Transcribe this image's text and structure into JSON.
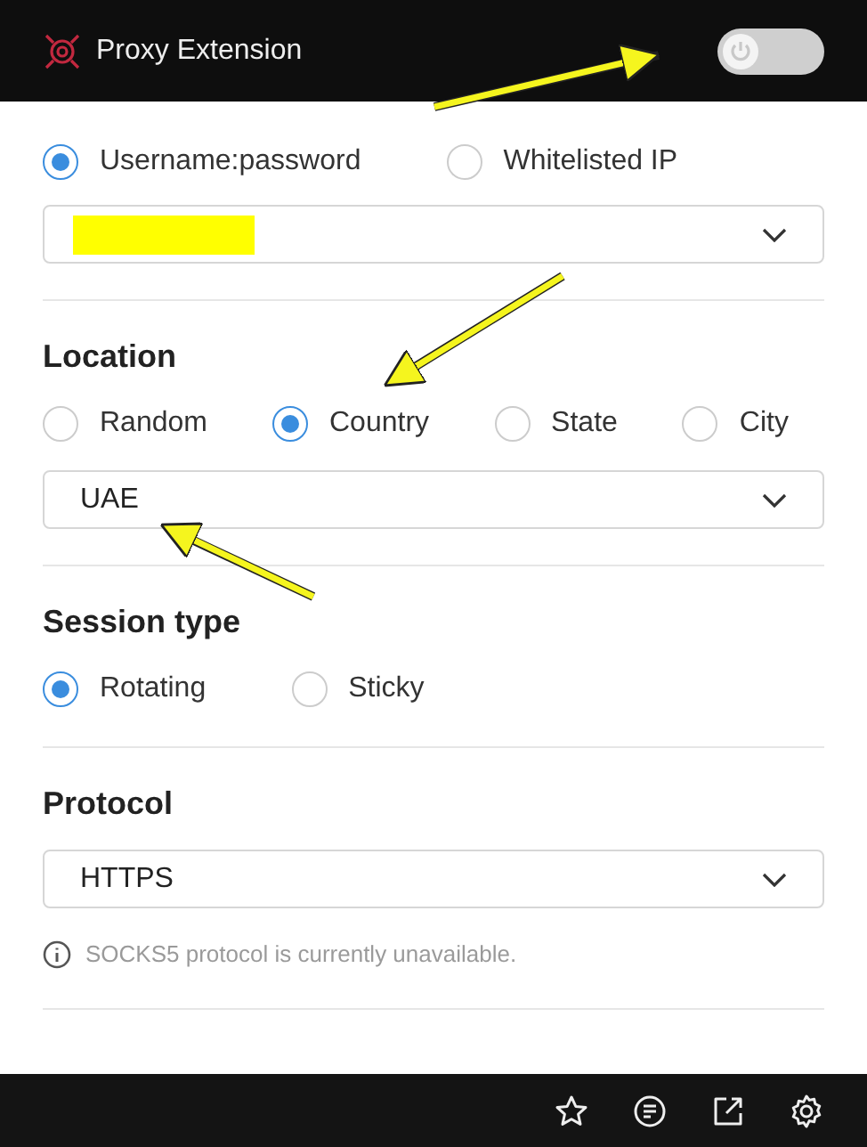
{
  "header": {
    "title": "Proxy Extension",
    "power_toggle": {
      "on": false
    }
  },
  "auth": {
    "options": [
      {
        "label": "Username:password",
        "selected": true
      },
      {
        "label": "Whitelisted IP",
        "selected": false
      }
    ],
    "select": {
      "redacted": true
    }
  },
  "location": {
    "title": "Location",
    "options": [
      {
        "label": "Random",
        "selected": false
      },
      {
        "label": "Country",
        "selected": true
      },
      {
        "label": "State",
        "selected": false
      },
      {
        "label": "City",
        "selected": false
      }
    ],
    "select": {
      "value": "UAE"
    }
  },
  "session": {
    "title": "Session type",
    "options": [
      {
        "label": "Rotating",
        "selected": true
      },
      {
        "label": "Sticky",
        "selected": false
      }
    ]
  },
  "protocol": {
    "title": "Protocol",
    "select": {
      "value": "HTTPS"
    },
    "note": "SOCKS5 protocol is currently unavailable."
  }
}
